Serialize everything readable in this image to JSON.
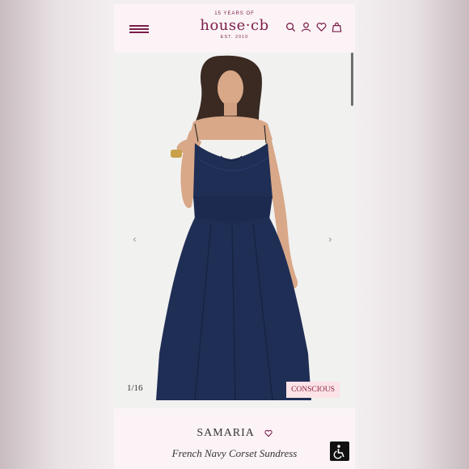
{
  "header": {
    "logo_top": "15 YEARS OF",
    "logo_main": "house·cb",
    "logo_bottom": "EST. 2010",
    "icons": [
      "menu-icon",
      "search-icon",
      "account-icon",
      "wishlist-icon",
      "bag-icon"
    ]
  },
  "gallery": {
    "counter": "1/16",
    "badge": "CONSCIOUS",
    "prev_arrow": "‹",
    "next_arrow": "›"
  },
  "product": {
    "name": "SAMARIA",
    "subtitle": "French Navy Corset Sundress"
  },
  "colors": {
    "brand": "#7b1d4b",
    "dress": "#1f2e55",
    "background": "#fbf3f5"
  }
}
